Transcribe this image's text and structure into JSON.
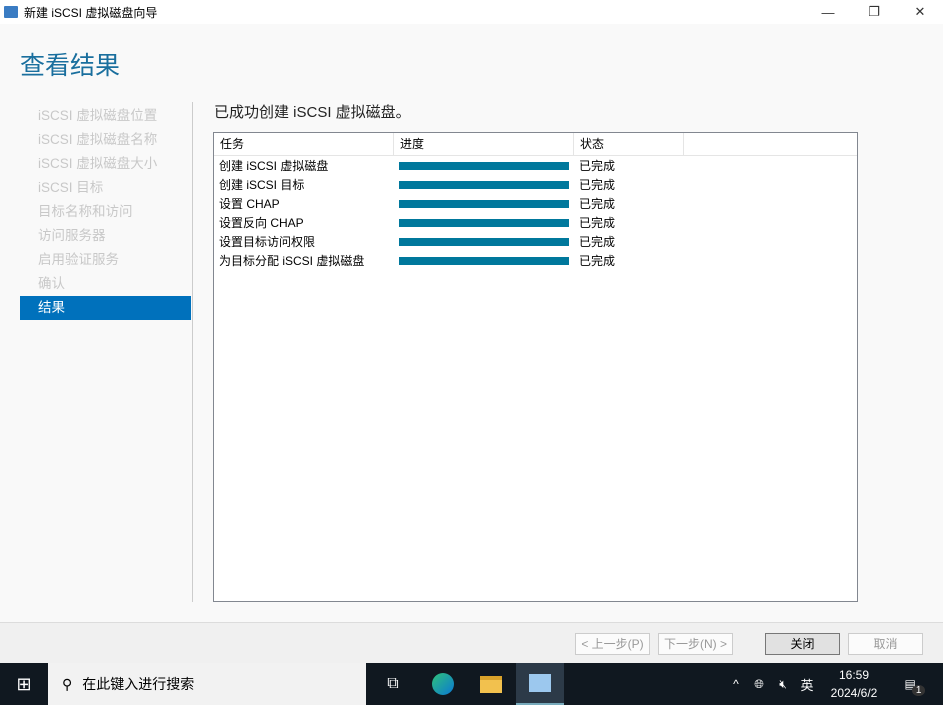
{
  "window": {
    "title": "新建 iSCSI 虚拟磁盘向导"
  },
  "page_title": "查看结果",
  "nav": [
    "iSCSI 虚拟磁盘位置",
    "iSCSI 虚拟磁盘名称",
    "iSCSI 虚拟磁盘大小",
    "iSCSI 目标",
    "目标名称和访问",
    "访问服务器",
    "启用验证服务",
    "确认",
    "结果"
  ],
  "heading": "已成功创建 iSCSI 虚拟磁盘。",
  "table": {
    "headers": [
      "任务",
      "进度",
      "状态"
    ],
    "rows": [
      {
        "task": "创建 iSCSI 虚拟磁盘",
        "progress": 100,
        "status": "已完成"
      },
      {
        "task": "创建 iSCSI 目标",
        "progress": 100,
        "status": "已完成"
      },
      {
        "task": "设置 CHAP",
        "progress": 100,
        "status": "已完成"
      },
      {
        "task": "设置反向 CHAP",
        "progress": 100,
        "status": "已完成"
      },
      {
        "task": "设置目标访问权限",
        "progress": 100,
        "status": "已完成"
      },
      {
        "task": "为目标分配 iSCSI 虚拟磁盘",
        "progress": 100,
        "status": "已完成"
      }
    ]
  },
  "buttons": {
    "prev": "< 上一步(P)",
    "next": "下一步(N) >",
    "close": "关闭",
    "cancel": "取消"
  },
  "taskbar": {
    "search_placeholder": "在此键入进行搜索",
    "ime": "英",
    "time": "16:59",
    "date": "2024/6/2",
    "notifications": "1"
  }
}
